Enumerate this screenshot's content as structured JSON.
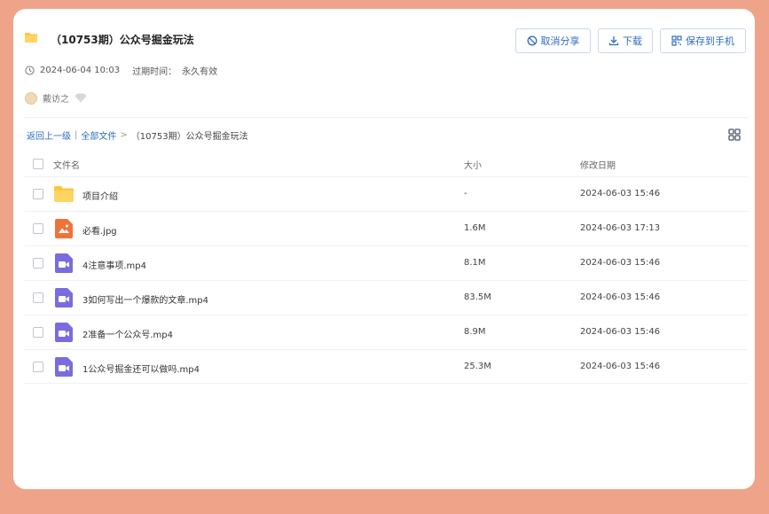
{
  "header": {
    "title": "（10753期）公众号掘金玩法",
    "buttons": {
      "cancel_share": "取消分享",
      "download": "下载",
      "save_to_phone": "保存到手机"
    }
  },
  "meta": {
    "shared_time": "2024-06-04 10:03",
    "expire_label": "过期时间：",
    "expire_value": "永久有效"
  },
  "user": {
    "name": "戴访之"
  },
  "breadcrumb": {
    "back": "返回上一级",
    "separator": "|",
    "all_files": "全部文件",
    "arrow": ">",
    "current": "（10753期）公众号掘金玩法"
  },
  "table": {
    "columns": {
      "name": "文件名",
      "size": "大小",
      "modified": "修改日期"
    },
    "rows": [
      {
        "name": "项目介绍",
        "size": "-",
        "modified": "2024-06-03 15:46",
        "icon": "folder-icon"
      },
      {
        "name": "必看.jpg",
        "size": "1.6M",
        "modified": "2024-06-03 17:13",
        "icon": "image-file-icon"
      },
      {
        "name": "4注意事项.mp4",
        "size": "8.1M",
        "modified": "2024-06-03 15:46",
        "icon": "video-file-icon"
      },
      {
        "name": "3如何写出一个爆款的文章.mp4",
        "size": "83.5M",
        "modified": "2024-06-03 15:46",
        "icon": "video-file-icon"
      },
      {
        "name": "2准备一个公众号.mp4",
        "size": "8.9M",
        "modified": "2024-06-03 15:46",
        "icon": "video-file-icon"
      },
      {
        "name": "1公众号掘金还可以做吗.mp4",
        "size": "25.3M",
        "modified": "2024-06-03 15:46",
        "icon": "video-file-icon"
      }
    ]
  },
  "colors": {
    "background": "#EFA48A",
    "accent": "#2E6CC0",
    "folder": "#FFC53D",
    "image_icon": "#F0723A",
    "video_icon": "#7A6CE0"
  }
}
